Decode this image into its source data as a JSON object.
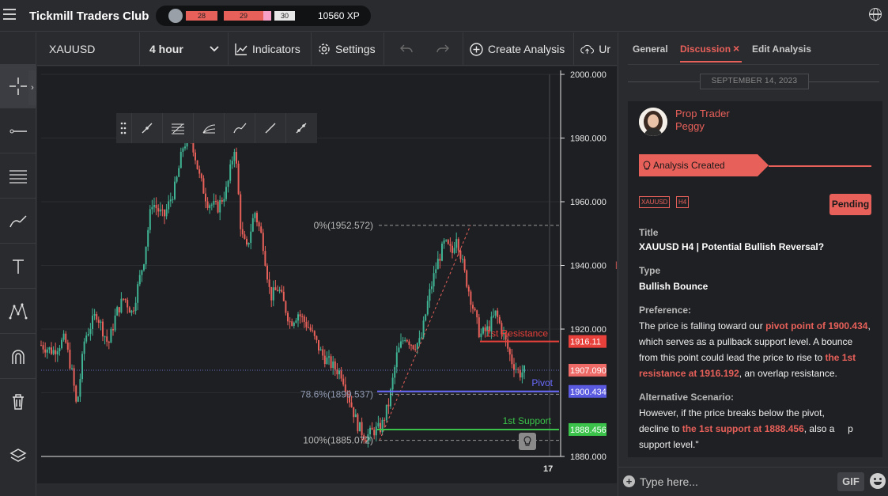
{
  "topbar": {
    "brand": "Tickmill Traders Club",
    "xp_levels": [
      "28",
      "29",
      "30"
    ],
    "xp_value": "10560 XP"
  },
  "toolbar": {
    "symbol": "XAUUSD",
    "timeframe": "4 hour",
    "indicators": "Indicators",
    "settings": "Settings",
    "create_analysis": "Create Analysis",
    "upload": "Ur"
  },
  "chart": {
    "y_ticks": [
      "2000.000",
      "1980.000",
      "1960.000",
      "1940.000",
      "1920.000",
      "1880.000"
    ],
    "x_tick": "17",
    "fib_0": "0%(1952.572)",
    "fib_786": "78.6%(1899.537)",
    "fib_100": "100%(1885.072)",
    "resistance_label": "1st Resistance",
    "pivot_label": "Pivot",
    "support_label": "1st Support",
    "price_resistance": "1916.11",
    "price_current": "1907.090",
    "price_pivot": "1900.434",
    "price_support": "1888.456"
  },
  "panel": {
    "tabs": [
      "General",
      "Discussion",
      "Edit Analysis"
    ],
    "close_glyph": "×",
    "date": "SEPTEMBER 14, 2023",
    "author_role": "Prop Trader",
    "author_name": "Peggy",
    "flag": "Analysis Created",
    "tags": [
      "XAUUSD",
      "H4"
    ],
    "status": "Pending",
    "title_label": "Title",
    "title_value": "XAUUSD H4 | Potential Bullish Reversal?",
    "type_label": "Type",
    "type_value": "Bullish Bounce",
    "pref_label": "Preference:",
    "pref_1": "The price is falling toward our ",
    "pref_hl1": "pivot point of 1900.434",
    "pref_2": ", which serves as a pullback support level. A bounce from this point could lead the price to rise to ",
    "pref_hl2": "the 1st resistance at 1916.192",
    "pref_3": ", an overlap resistance.",
    "alt_label": "Alternative Scenario:",
    "alt_1": " However, if the price breaks below the pivot, ",
    "alt_2": "decline to ",
    "alt_hl1": "the 1st support at 1888.456",
    "alt_3": ", also a",
    "alt_4": "p",
    "alt_5": "support level.\"",
    "input_placeholder": "Type here...",
    "gif": "GIF"
  }
}
